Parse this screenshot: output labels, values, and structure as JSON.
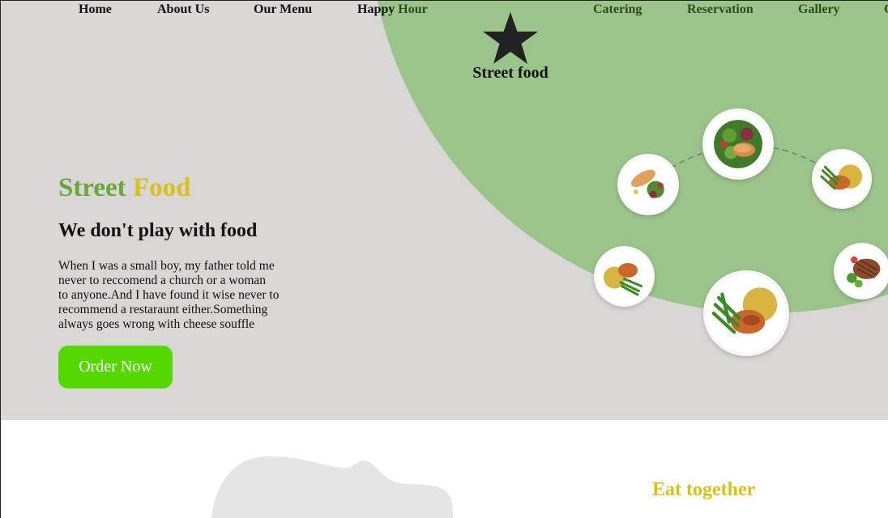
{
  "nav": {
    "items": [
      {
        "label": "Home"
      },
      {
        "label": "About Us"
      },
      {
        "label": "Our Menu"
      },
      {
        "label": "Happy",
        "label_tail": " Hour"
      },
      {
        "label": "Catering"
      },
      {
        "label": "Reservation"
      },
      {
        "label": "Gallery"
      },
      {
        "label": "C"
      }
    ]
  },
  "logo": {
    "icon": "star-icon",
    "text": "Street food"
  },
  "hero": {
    "brand_word1": "Street",
    "brand_word2": "Food",
    "tagline": "We don't play with food",
    "description_lines": [
      "When I was a small boy, my father told me",
      "never to reccomend a church or a woman",
      "to anyone.And I have found it wise never to",
      "recommend a restaraunt either.Something",
      "always goes wrong with cheese souffle"
    ],
    "order_button": "Order Now"
  },
  "plates": [
    {
      "name": "grilled-salmon-salad"
    },
    {
      "name": "sliced-fish-greens"
    },
    {
      "name": "chicken-rice-beans"
    },
    {
      "name": "steak-vegetables"
    },
    {
      "name": "chicken-beans-rice-large"
    },
    {
      "name": "chicken-rice-beans-small"
    }
  ],
  "section2": {
    "title": "Eat together"
  },
  "colors": {
    "hero_bg": "#d9d6d6",
    "green_blob": "#9bc48a",
    "brand_green": "#6aa83a",
    "brand_yellow": "#d6c21a",
    "button_green": "#55d800"
  }
}
